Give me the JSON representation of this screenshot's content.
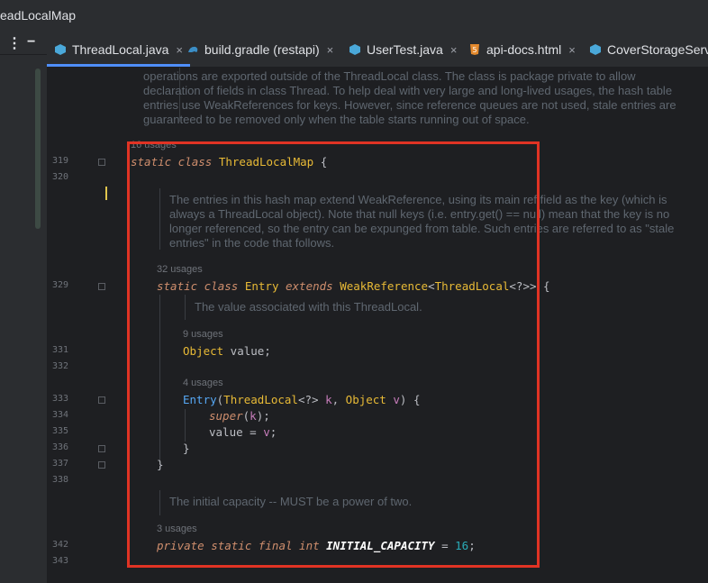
{
  "window": {
    "title": "eadLocalMap"
  },
  "tabs": [
    {
      "label": "ThreadLocal.java",
      "icon": "java-class-icon",
      "active": true
    },
    {
      "label": "build.gradle (restapi)",
      "icon": "gradle-icon",
      "active": false
    },
    {
      "label": "UserTest.java",
      "icon": "java-class-icon",
      "active": false
    },
    {
      "label": "api-docs.html",
      "icon": "html-icon",
      "active": false
    },
    {
      "label": "CoverStorageServi",
      "icon": "java-class-icon",
      "active": false
    }
  ],
  "doc_top": [
    "operations are exported outside of the ThreadLocal class. The class is package private to allow",
    "declaration of fields in class Thread. To help deal with very large and long-lived usages, the hash table",
    "entries use WeakReferences for keys. However, since reference queues are not used, stale entries are",
    "guaranteed to be removed only when the table starts running out of space."
  ],
  "doc_entry": [
    "The entries in this hash map extend WeakReference, using its main ref field as the key (which is",
    "always a ThreadLocal object). Note that null keys (i.e. entry.get() == null) mean that the key is no",
    "longer referenced, so the entry can be expunged from table. Such entries are referred to as \"stale",
    "entries\" in the code that follows."
  ],
  "doc_value": "The value associated with this ThreadLocal.",
  "doc_capacity": "The initial capacity -- MUST be a power of two.",
  "usages": {
    "map": "16 usages",
    "entry": "32 usages",
    "value": "9 usages",
    "ctor": "4 usages",
    "capacity": "3 usages"
  },
  "line_numbers": {
    "l319": "319",
    "l320": "320",
    "l329": "329",
    "l331": "331",
    "l332": "332",
    "l333": "333",
    "l334": "334",
    "l335": "335",
    "l336": "336",
    "l337": "337",
    "l338": "338",
    "l342": "342",
    "l343": "343"
  },
  "code": {
    "map_kw": "static class ",
    "map_name": "ThreadLocalMap",
    "map_brace": " {",
    "entry_kw1": "static class ",
    "entry_name": "Entry",
    "entry_kw2": " extends ",
    "entry_super": "WeakReference",
    "entry_gen1": "<",
    "entry_tl": "ThreadLocal",
    "entry_gen2": "<?>> {",
    "value_type": "Object",
    "value_name": " value;",
    "ctor_name": "Entry",
    "ctor_p1": "(",
    "ctor_tl": "ThreadLocal",
    "ctor_p2": "<?> ",
    "ctor_k": "k",
    "ctor_p3": ", ",
    "ctor_obj": "Object",
    "ctor_p4": " ",
    "ctor_v": "v",
    "ctor_p5": ") {",
    "super_kw": "super",
    "super_p1": "(",
    "super_k": "k",
    "super_p2": ");",
    "assign_lhs": "value = ",
    "assign_v": "v",
    "assign_end": ";",
    "close_inner": "}",
    "close_entry": "}",
    "cap_kw": "private static final int ",
    "cap_name": "INITIAL_CAPACITY",
    "cap_eq": " = ",
    "cap_num": "16",
    "cap_end": ";"
  },
  "colors": {
    "highlight_box": "#e03324",
    "active_tab_underline": "#4f8ffa"
  }
}
